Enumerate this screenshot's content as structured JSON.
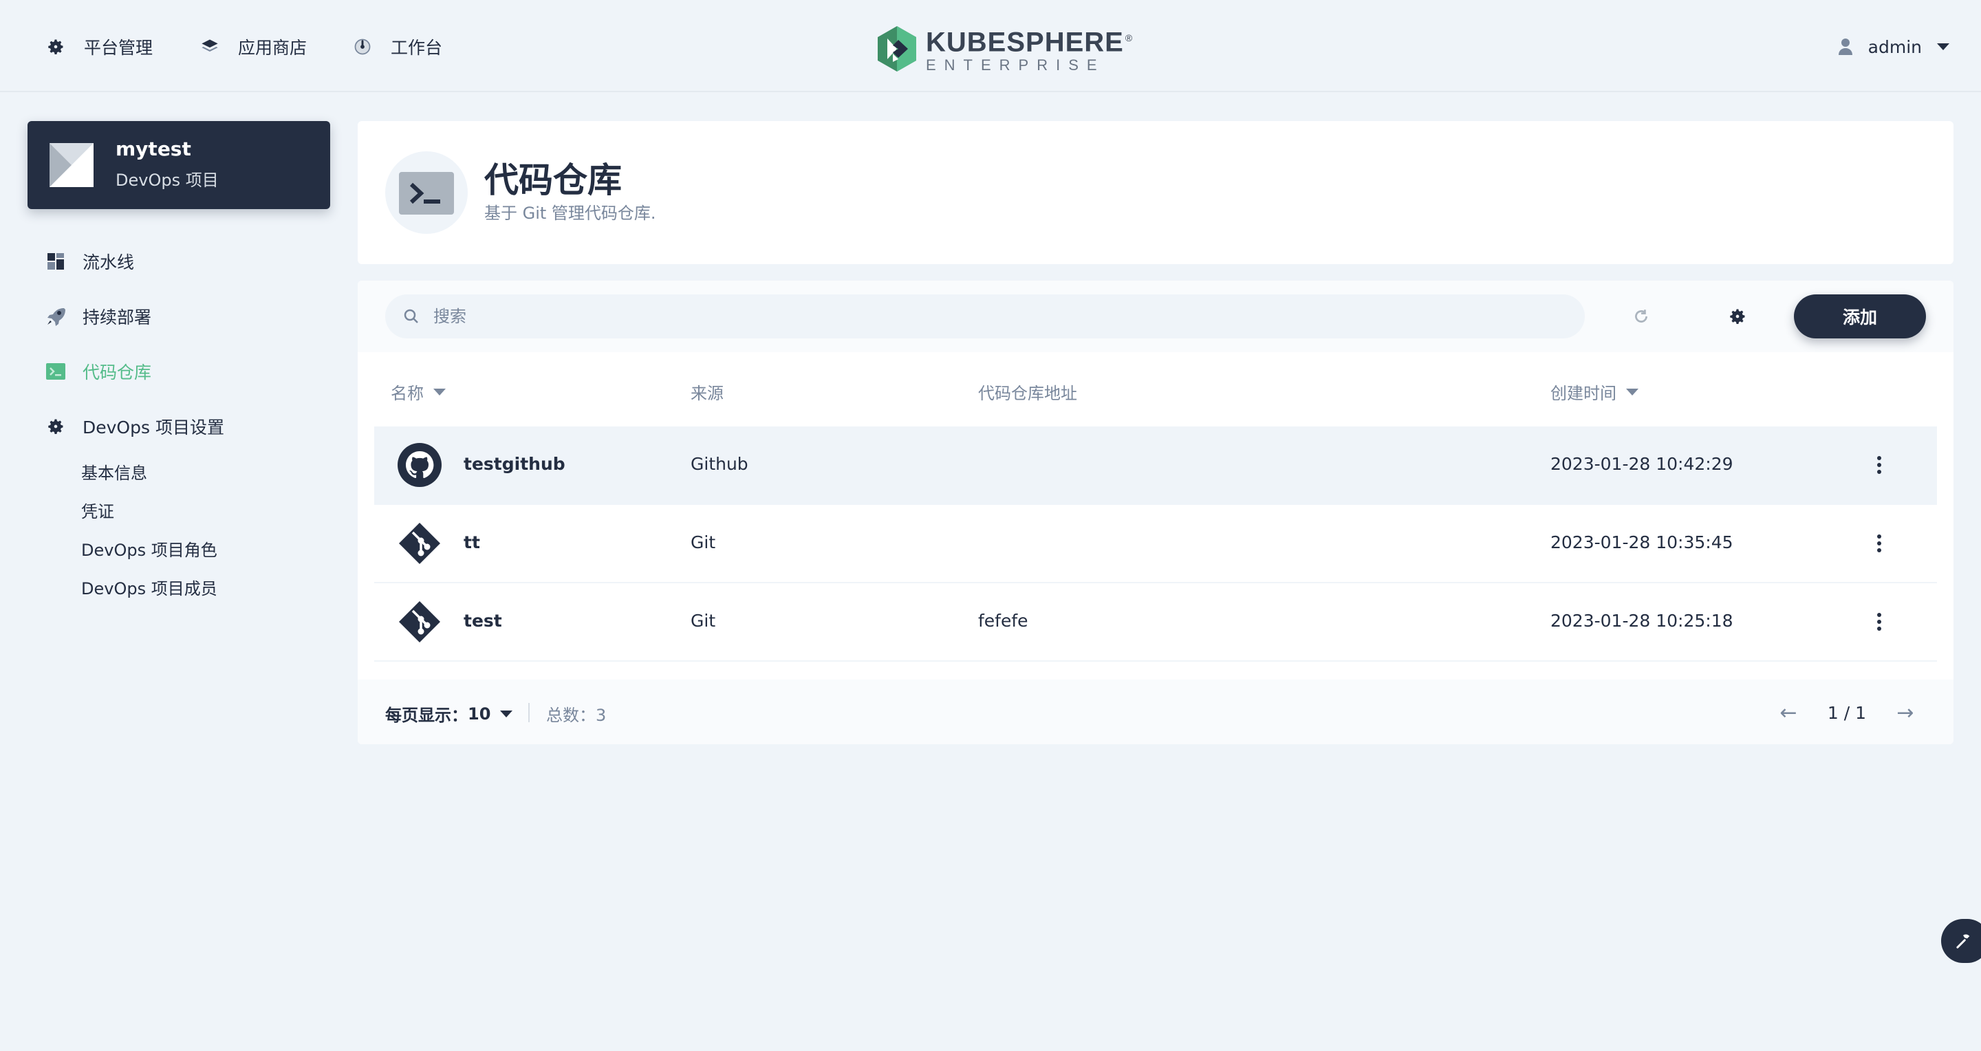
{
  "topnav": {
    "items": [
      {
        "label": "平台管理",
        "icon": "gear-icon"
      },
      {
        "label": "应用商店",
        "icon": "layers-icon"
      },
      {
        "label": "工作台",
        "icon": "dashboard-icon"
      }
    ],
    "logo": {
      "brand": "KUBESPHERE",
      "reg": "®",
      "sub": "ENTERPRISE"
    },
    "user": "admin"
  },
  "project": {
    "name": "mytest",
    "type": "DevOps 项目"
  },
  "sidebar": {
    "items": [
      {
        "label": "流水线",
        "icon": "pipeline-icon"
      },
      {
        "label": "持续部署",
        "icon": "rocket-icon"
      },
      {
        "label": "代码仓库",
        "icon": "terminal-icon",
        "active": true
      },
      {
        "label": "DevOps 项目设置",
        "icon": "gear-icon"
      }
    ],
    "settings": [
      "基本信息",
      "凭证",
      "DevOps 项目角色",
      "DevOps 项目成员"
    ]
  },
  "page": {
    "title": "代码仓库",
    "description": "基于 Git 管理代码仓库."
  },
  "toolbar": {
    "search_placeholder": "搜索",
    "add_label": "添加"
  },
  "table": {
    "columns": [
      "名称",
      "来源",
      "代码仓库地址",
      "创建时间"
    ],
    "rows": [
      {
        "name": "testgithub",
        "source": "Github",
        "address": "",
        "created": "2023-01-28 10:42:29",
        "icon": "github-icon"
      },
      {
        "name": "tt",
        "source": "Git",
        "address": "",
        "created": "2023-01-28 10:35:45",
        "icon": "git-icon"
      },
      {
        "name": "test",
        "source": "Git",
        "address": "fefefe",
        "created": "2023-01-28 10:25:18",
        "icon": "git-icon"
      }
    ]
  },
  "footer": {
    "per_page_label": "每页显示：",
    "per_page": "10",
    "total": "总数：3",
    "page": "1 / 1"
  },
  "colors": {
    "accent": "#55bc8a",
    "dark": "#242e42",
    "muted": "#79879c",
    "background": "#eff4f9"
  }
}
